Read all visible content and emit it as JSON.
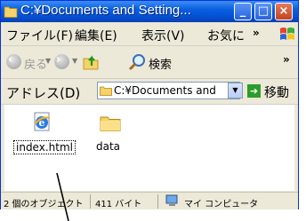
{
  "window": {
    "title": "C:¥Documents and Setting...",
    "controls": {
      "minimize": "_",
      "maximize": "□",
      "close": "×"
    }
  },
  "menu": {
    "items": [
      "ファイル(F)",
      "編集(E)",
      "表示(V)",
      "お気に"
    ],
    "more": "»"
  },
  "toolbar": {
    "back_label": "戻る",
    "search_label": "検索",
    "more": "»"
  },
  "address": {
    "label": "アドレス(D)",
    "value": "C:¥Documents and",
    "go_label": "移動"
  },
  "files": [
    {
      "name": "index.html",
      "icon": "ie-html-icon"
    },
    {
      "name": "data",
      "icon": "folder-icon"
    }
  ],
  "status": {
    "count": "2 個のオブジェクト",
    "size": "411 バイト",
    "location": "マイ コンピュータ"
  },
  "colors": {
    "titlebar": "#0a5fe0",
    "window_face": "#ece9d8",
    "close_button": "#c1441f"
  }
}
